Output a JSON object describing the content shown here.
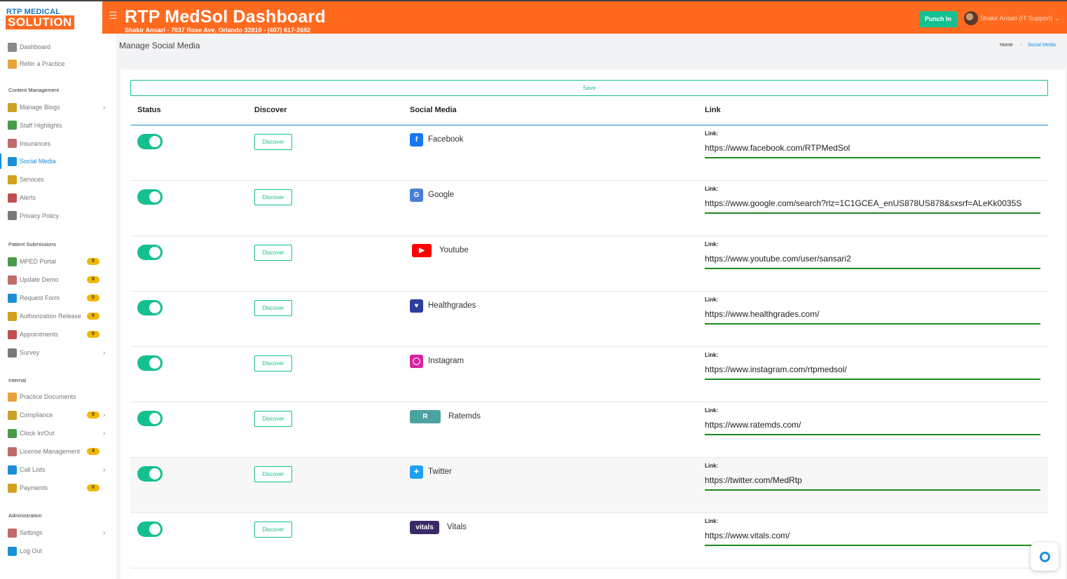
{
  "header": {
    "logo_top": "RTP MEDICAL",
    "logo_bottom": "SOLUTION",
    "title": "RTP MedSol Dashboard",
    "subtitle": "Shakir Ansari - 7037 Rose Ave, Orlando 32810 - (407) 617-2692",
    "punch_in": "Punch In",
    "user": "Shakir Ansari (IT Support)",
    "accent": "#ff6a1f"
  },
  "sidebar": {
    "top": [
      {
        "label": "Dashboard",
        "icon": "dashboard-icon"
      },
      {
        "label": "Refer a Practice",
        "icon": "refer-icon"
      }
    ],
    "content_title": "Content Management",
    "content": [
      {
        "label": "Manage Blogs",
        "icon": "blog-icon",
        "chevron": true
      },
      {
        "label": "Staff Highlights",
        "icon": "staff-icon"
      },
      {
        "label": "Insurances",
        "icon": "insurance-icon"
      },
      {
        "label": "Social Media",
        "icon": "social-media-icon",
        "active": true
      },
      {
        "label": "Services",
        "icon": "services-icon"
      },
      {
        "label": "Alerts",
        "icon": "alerts-icon"
      },
      {
        "label": "Privacy Policy",
        "icon": "privacy-icon"
      }
    ],
    "patient_title": "Patient Submissions",
    "patient": [
      {
        "label": "MPED Portal",
        "badge": "0"
      },
      {
        "label": "Update Demo",
        "badge": "0"
      },
      {
        "label": "Request Form",
        "badge": "0"
      },
      {
        "label": "Authorization Release",
        "badge": "0"
      },
      {
        "label": "Appointments",
        "badge": "0"
      },
      {
        "label": "Survey",
        "chevron": true
      }
    ],
    "internal_title": "Internal",
    "internal": [
      {
        "label": "Practice Documents"
      },
      {
        "label": "Compliance",
        "badge": "0",
        "chevron": true
      },
      {
        "label": "Clock In/Out",
        "chevron": true
      },
      {
        "label": "License Management",
        "badge": "4"
      },
      {
        "label": "Call Lists",
        "chevron": true
      },
      {
        "label": "Payments",
        "badge": "0"
      }
    ],
    "admin_title": "Administration",
    "admin": [
      {
        "label": "Settings",
        "chevron": true
      },
      {
        "label": "Log Out"
      }
    ]
  },
  "page": {
    "title": "Manage Social Media",
    "breadcrumb_home": "Home",
    "breadcrumb_current": "Social Media",
    "save": "Save",
    "columns": [
      "Status",
      "Discover",
      "Social Media",
      "Link"
    ],
    "discover_label": "Discover",
    "link_label": "Link:"
  },
  "rows": [
    {
      "name": "Facebook",
      "link": "https://www.facebook.com/RTPMedSol",
      "icon": "facebook-icon",
      "color": "#1877f2"
    },
    {
      "name": "Google",
      "link": "https://www.google.com/search?rlz=1C1GCEA_enUS878US878&sxsrf=ALeKk0035S",
      "icon": "google-icon",
      "color": "#4a7fd6"
    },
    {
      "name": "Youtube",
      "link": "https://www.youtube.com/user/sansari2",
      "icon": "youtube-icon",
      "color": "#ff0000"
    },
    {
      "name": "Healthgrades",
      "link": "https://www.healthgrades.com/",
      "icon": "healthgrades-icon",
      "color": "#2c3e9e"
    },
    {
      "name": "Instagram",
      "link": "https://www.instagram.com/rtpmedsol/",
      "icon": "instagram-icon",
      "color": "#d6249f"
    },
    {
      "name": "Ratemds",
      "link": "https://www.ratemds.com/",
      "icon": "ratemds-icon",
      "color": "#4aa3a0"
    },
    {
      "name": "Twitter",
      "link": "https://twitter.com/MedRtp",
      "icon": "twitter-icon",
      "color": "#1da1f2"
    },
    {
      "name": "Vitals",
      "link": "https://www.vitals.com/",
      "icon": "vitals-icon",
      "color": "#3a2a6a"
    }
  ]
}
